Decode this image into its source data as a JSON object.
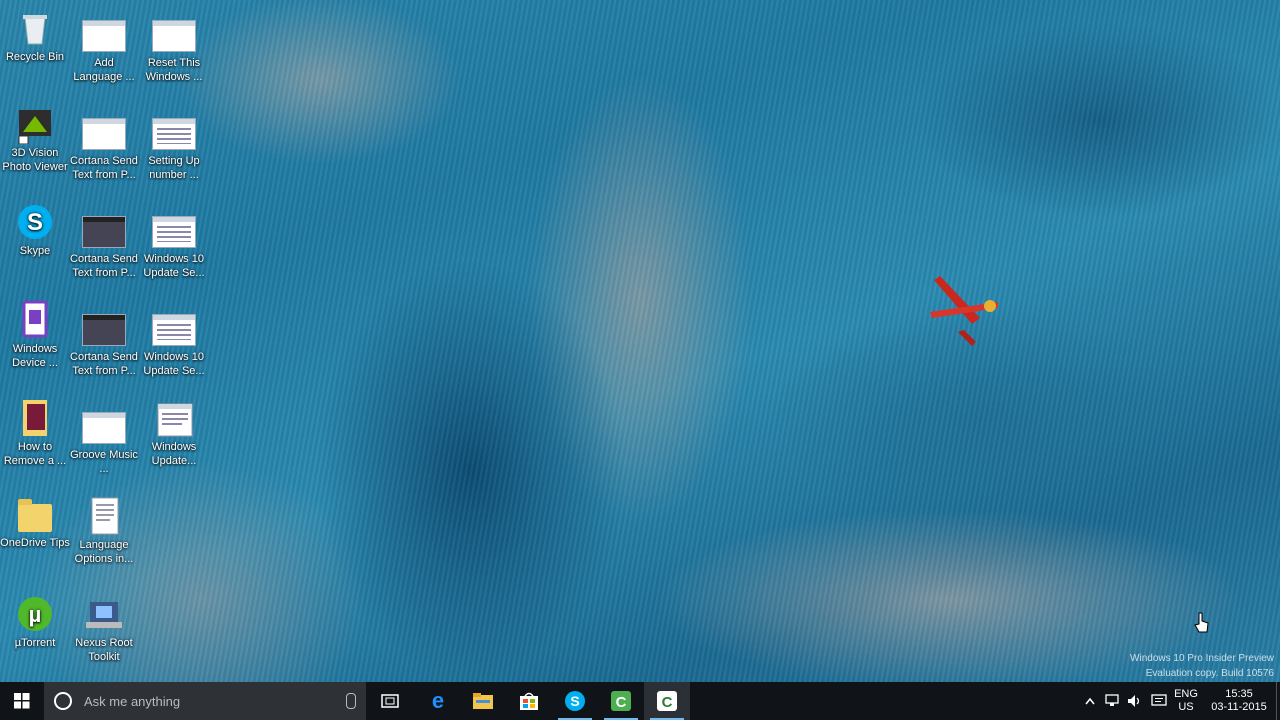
{
  "desktop": {
    "icons": [
      {
        "label": "Recycle Bin"
      },
      {
        "label": "Add Language ..."
      },
      {
        "label": "Reset This Windows ..."
      },
      {
        "label": "3D Vision Photo Viewer"
      },
      {
        "label": "Cortana Send Text from P..."
      },
      {
        "label": "Setting Up number ..."
      },
      {
        "label": "Skype"
      },
      {
        "label": "Cortana Send Text from P..."
      },
      {
        "label": "Windows 10 Update Se..."
      },
      {
        "label": "Windows Device ..."
      },
      {
        "label": "Cortana Send Text from P..."
      },
      {
        "label": "Windows 10 Update Se..."
      },
      {
        "label": "How to Remove a ..."
      },
      {
        "label": "Groove Music ..."
      },
      {
        "label": "Windows Update..."
      },
      {
        "label": "OneDrive Tips"
      },
      {
        "label": "Language Options in..."
      },
      {
        "label": "µTorrent"
      },
      {
        "label": "Nexus Root Toolkit"
      }
    ]
  },
  "watermark": {
    "line1": "Windows 10 Pro Insider Preview",
    "line2": "Evaluation copy. Build 10576"
  },
  "taskbar": {
    "search_placeholder": "Ask me anything",
    "pinned": [
      {
        "icon": "task-view-icon"
      },
      {
        "icon": "edge-icon"
      },
      {
        "icon": "file-explorer-icon"
      },
      {
        "icon": "store-icon"
      },
      {
        "icon": "skype-icon"
      },
      {
        "icon": "camtasia-icon"
      },
      {
        "icon": "camtasia-icon"
      }
    ],
    "tray": {
      "language": "ENG",
      "region": "US",
      "time": "15:35",
      "date": "03-11-2015"
    }
  },
  "colors": {
    "taskbar_bg": "#101418",
    "accent": "#76b9ed",
    "skype": "#00aff0",
    "camtasia": "#4caf50"
  }
}
